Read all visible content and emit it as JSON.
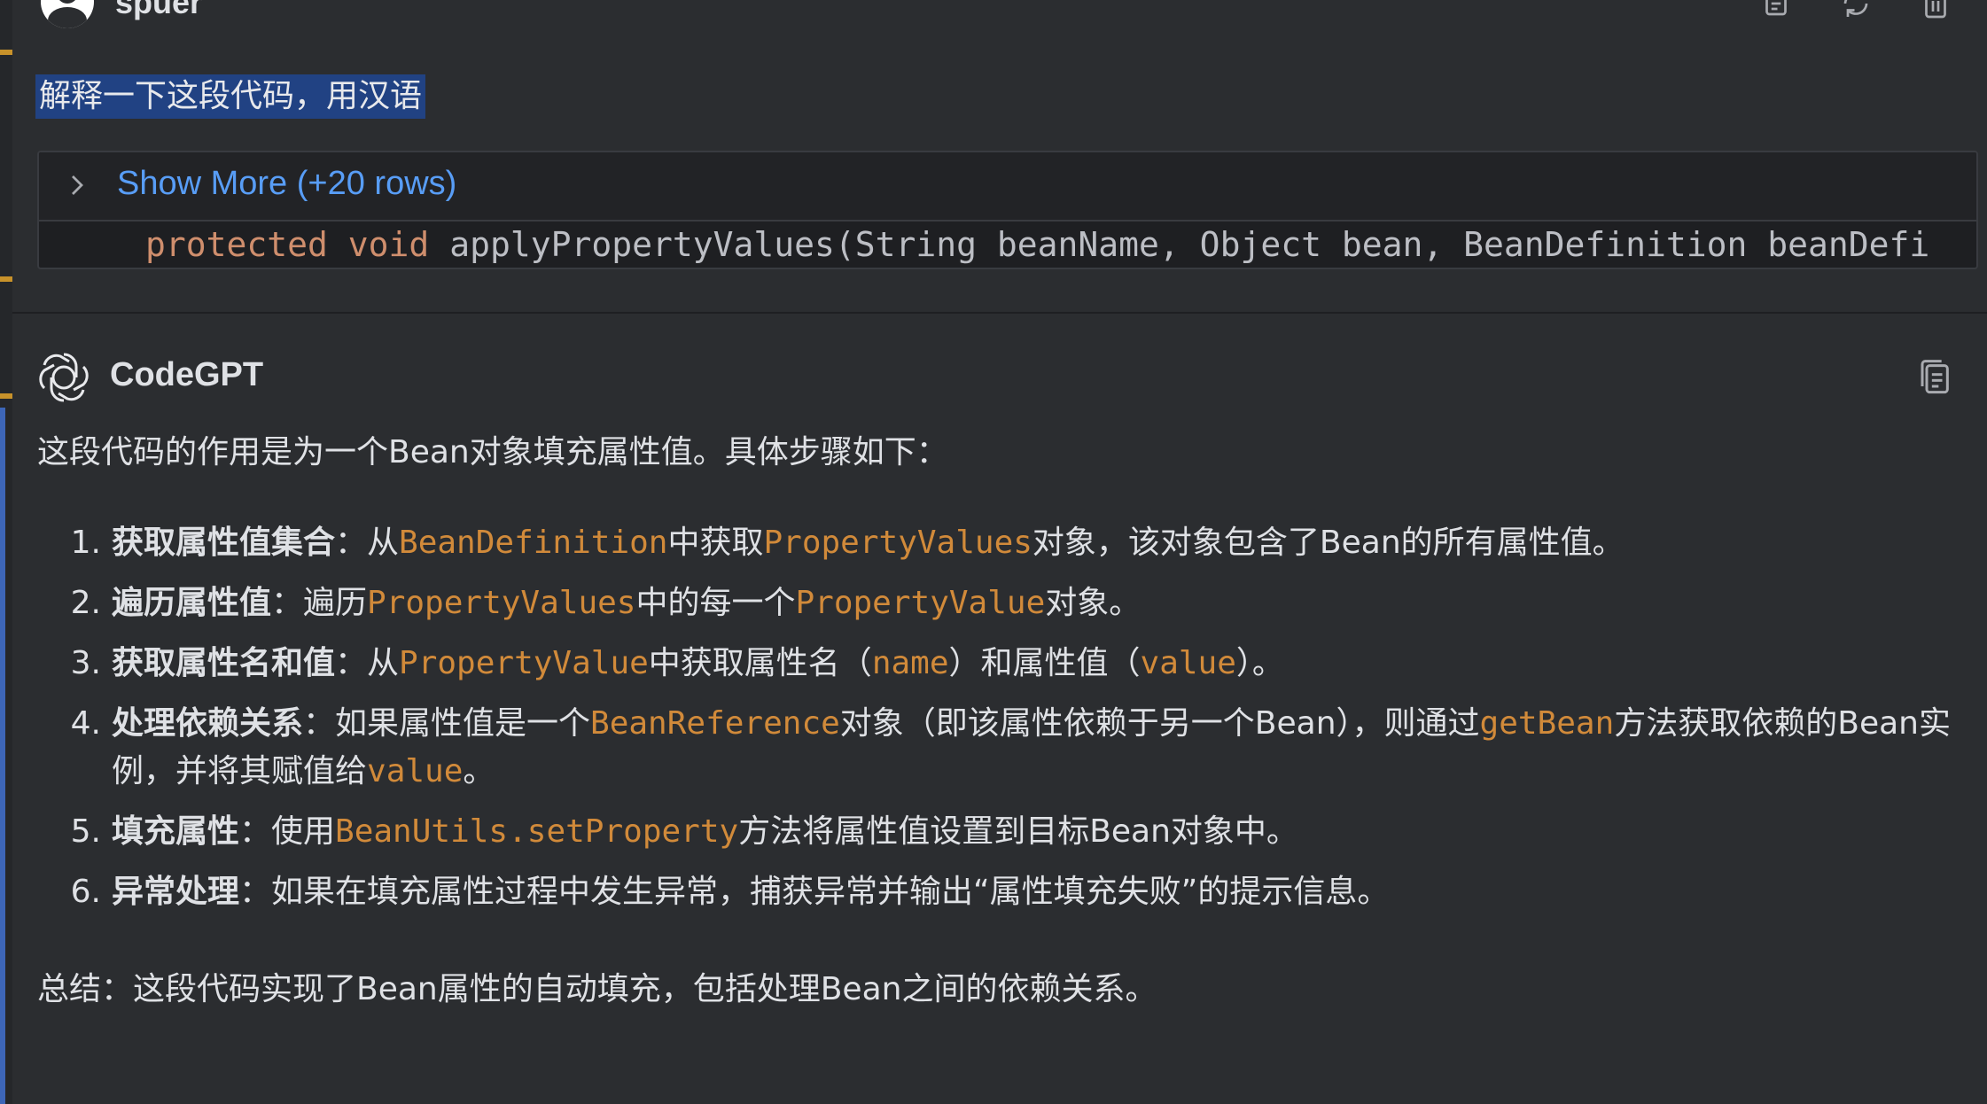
{
  "user_message": {
    "username": "spuer",
    "prompt": "解释一下这段代码，用汉语",
    "code_block": {
      "show_more_label": "Show More (+20 rows)",
      "code_keyword_1": "protected",
      "code_keyword_2": "void",
      "code_rest": "applyPropertyValues(String beanName, Object bean, BeanDefinition beanDefi"
    },
    "icons": [
      "copy-icon",
      "regenerate-icon",
      "delete-icon"
    ]
  },
  "bot_message": {
    "name": "CodeGPT",
    "intro": "这段代码的作用是为一个Bean对象填充属性值。具体步骤如下：",
    "steps": [
      {
        "num": "1.",
        "title": "获取属性值集合",
        "parts": [
          "：从",
          "BeanDefinition",
          "中获取",
          "PropertyValues",
          "对象，该对象包含了Bean的所有属性值。"
        ]
      },
      {
        "num": "2.",
        "title": "遍历属性值",
        "parts": [
          "：遍历",
          "PropertyValues",
          "中的每一个",
          "PropertyValue",
          "对象。"
        ]
      },
      {
        "num": "3.",
        "title": "获取属性名和值",
        "parts": [
          "：从",
          "PropertyValue",
          "中获取属性名（",
          "name",
          "）和属性值（",
          "value",
          "）。"
        ]
      },
      {
        "num": "4.",
        "title": "处理依赖关系",
        "parts": [
          "：如果属性值是一个",
          "BeanReference",
          "对象（即该属性依赖于另一个Bean），则通过",
          "getBean",
          "方法获取依赖的Bean实例，并将其赋值给",
          "value",
          "。"
        ]
      },
      {
        "num": "5.",
        "title": "填充属性",
        "parts": [
          "：使用",
          "BeanUtils.setProperty",
          "方法将属性值设置到目标Bean对象中。"
        ]
      },
      {
        "num": "6.",
        "title": "异常处理",
        "parts": [
          "：如果在填充属性过程中发生异常，捕获异常并输出“属性填充失败”的提示信息。"
        ]
      }
    ],
    "summary": "总结：这段代码实现了Bean属性的自动填充，包括处理Bean之间的依赖关系。"
  },
  "colors": {
    "background": "#2b2d30",
    "code_ref": "#d18a3a",
    "link": "#589df6",
    "selection": "#214283",
    "keyword": "#cf8e6d"
  }
}
